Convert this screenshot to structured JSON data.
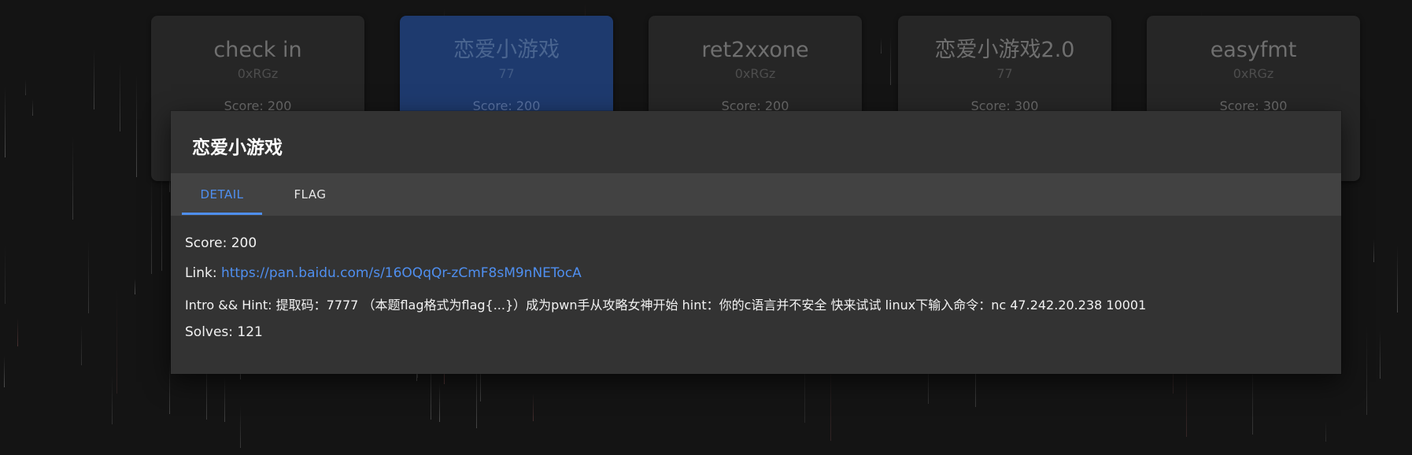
{
  "challenges": [
    {
      "title": "check in",
      "author": "0xRGz",
      "score": "Score: 200"
    },
    {
      "title": "恋爱小游戏",
      "author": "77",
      "score": "Score: 200"
    },
    {
      "title": "ret2xxone",
      "author": "0xRGz",
      "score": "Score: 200"
    },
    {
      "title": "恋爱小游戏2.0",
      "author": "77",
      "score": "Score: 300"
    },
    {
      "title": "easyfmt",
      "author": "0xRGz",
      "score": "Score: 300"
    }
  ],
  "dialog": {
    "title": "恋爱小游戏",
    "tabs": [
      {
        "label": "DETAIL",
        "active": true
      },
      {
        "label": "FLAG",
        "active": false
      }
    ],
    "detail": {
      "score": "Score: 200",
      "link_label": "Link: ",
      "link_url": "https://pan.baidu.com/s/16OQqQr-zCmF8sM9nNETocA",
      "intro": "Intro && Hint: 提取码：7777 （本题flag格式为flag{...}）成为pwn手从攻略女神开始 hint：你的c语言并不安全 快来试试 linux下输入命令：nc 47.242.20.238 10001",
      "solves": "Solves: 121"
    }
  },
  "colors": {
    "background": "#141414",
    "card": "#262626",
    "card_active": "#1e3a6e",
    "dialog": "#333333",
    "tabs_bar": "#424242",
    "accent": "#4f8ff0"
  }
}
